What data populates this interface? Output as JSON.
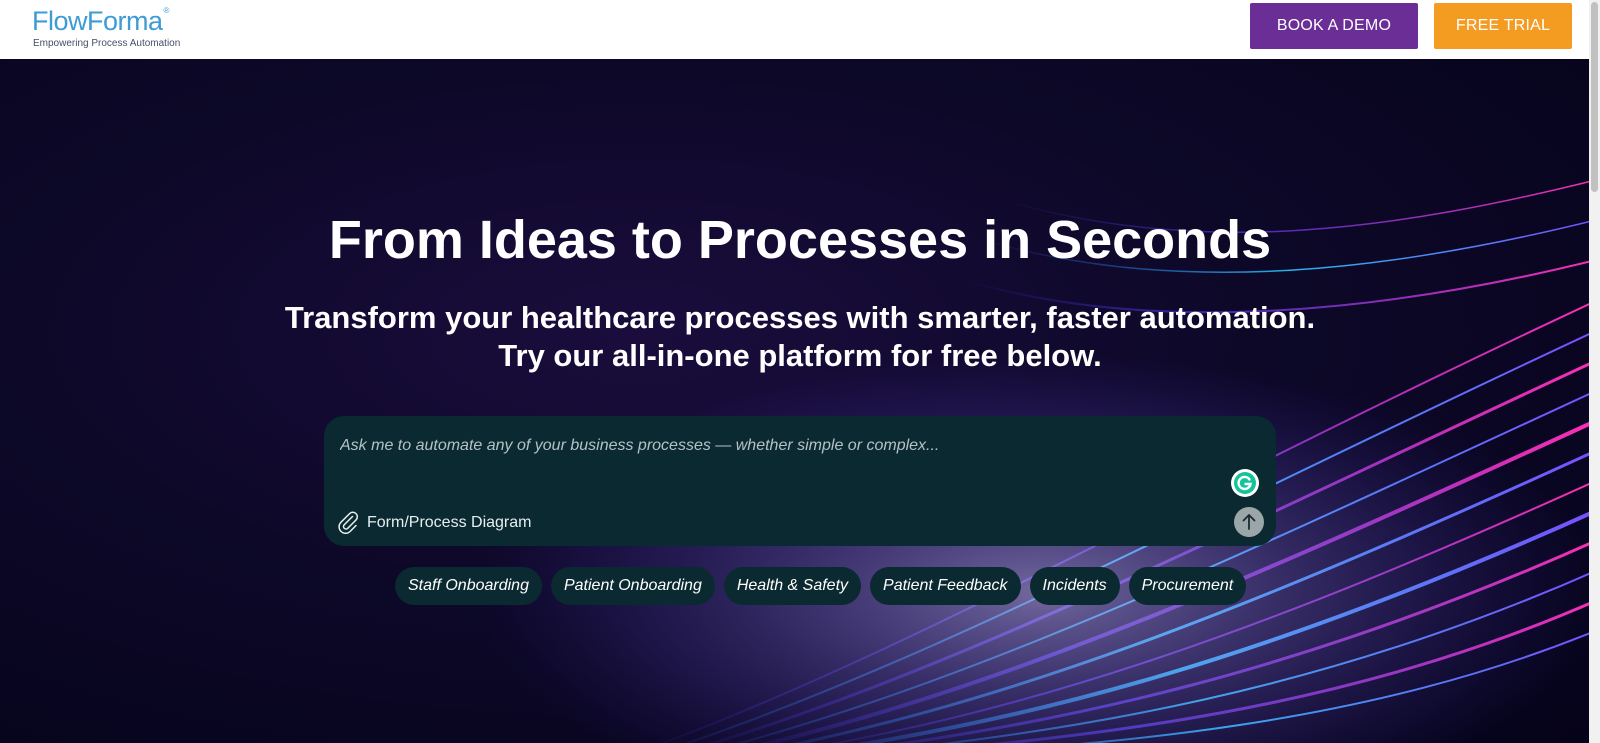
{
  "header": {
    "logo": {
      "name": "FlowForma",
      "registered": "®",
      "tagline": "Empowering Process Automation"
    },
    "book_demo_label": "BOOK A DEMO",
    "free_trial_label": "FREE TRIAL"
  },
  "hero": {
    "title": "From Ideas to Processes in Seconds",
    "subtitle_line1": "Transform your healthcare processes with smarter, faster automation.",
    "subtitle_line2": "Try our all-in-one platform for free below."
  },
  "prompt": {
    "placeholder": "Ask me to automate any of your business processes — whether simple or complex...",
    "attach_label": "Form/Process Diagram",
    "send_icon": "arrow-up-icon",
    "assistant_icon": "grammarly-icon"
  },
  "chips": [
    {
      "label": "Staff Onboarding"
    },
    {
      "label": "Patient Onboarding"
    },
    {
      "label": "Health & Safety"
    },
    {
      "label": "Patient Feedback"
    },
    {
      "label": "Incidents"
    },
    {
      "label": "Procurement"
    }
  ],
  "colors": {
    "brand_blue": "#3d9bd6",
    "demo_purple": "#6a2e96",
    "trial_orange": "#f49b22",
    "prompt_bg": "#0b2930"
  }
}
